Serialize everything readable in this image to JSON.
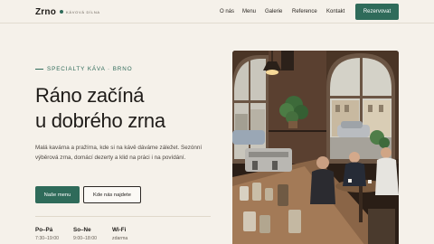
{
  "brand": {
    "name": "Zrno",
    "tagline": "KÁVOVÁ DÍLNA",
    "accent": "#2f6b5a"
  },
  "nav": {
    "items": [
      "O nás",
      "Menu",
      "Galerie",
      "Reference",
      "Kontakt"
    ],
    "cta": "Rezervovat"
  },
  "hero": {
    "eyebrow": "SPECIALTY KÁVA · BRNO",
    "headline_line1": "Ráno začíná",
    "headline_line2": "u dobrého zrna",
    "lead": "Malá kavárna a pražírna, kde si na kávě dáváme záležet. Sezónní výběrová zrna, domácí dezerty a klid na práci i na povídání.",
    "primary_button": "Naše menu",
    "secondary_button": "Kde nás najdete"
  },
  "info": [
    {
      "label": "Po–Pá",
      "value": "7:30–19:00"
    },
    {
      "label": "So–Ne",
      "value": "9:00–18:00"
    },
    {
      "label": "Wi-Fi",
      "value": "zdarma"
    }
  ],
  "photo": {
    "subject": "cafe-interior-photo"
  }
}
